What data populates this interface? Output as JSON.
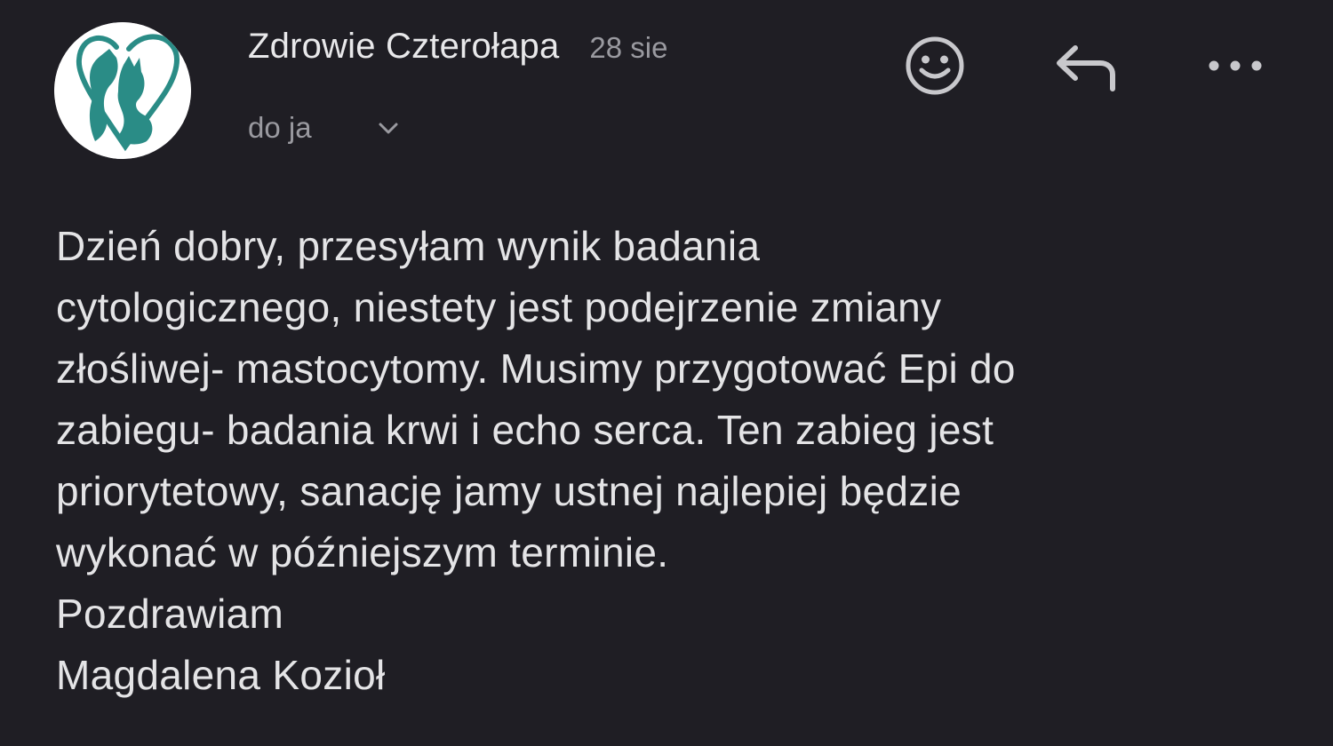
{
  "email": {
    "sender_name": "Zdrowie Czterołapa",
    "date": "28 sie",
    "recipient": "do ja",
    "body_lines": [
      "Dzień dobry, przesyłam wynik badania",
      "cytologicznego, niestety jest podejrzenie zmiany",
      "złośliwej- mastocytomy. Musimy przygotować Epi do",
      "zabiegu- badania krwi i echo serca. Ten zabieg jest",
      "priorytetowy, sanację jamy ustnej najlepiej będzie",
      "wykonać w późniejszym terminie.",
      "Pozdrawiam",
      "Magdalena Kozioł"
    ]
  },
  "actions": {
    "emoji_icon": "smiley-face-icon",
    "reply_icon": "reply-arrow-icon",
    "more_icon": "more-dots-icon"
  },
  "avatar": {
    "icon": "cat-dog-heart-logo",
    "accent_color": "#2a8c86"
  },
  "colors": {
    "background": "#1f1e24",
    "text_primary": "#e6e6e6",
    "text_secondary": "#9a9aa0",
    "icon_color": "#c8c8cc"
  }
}
